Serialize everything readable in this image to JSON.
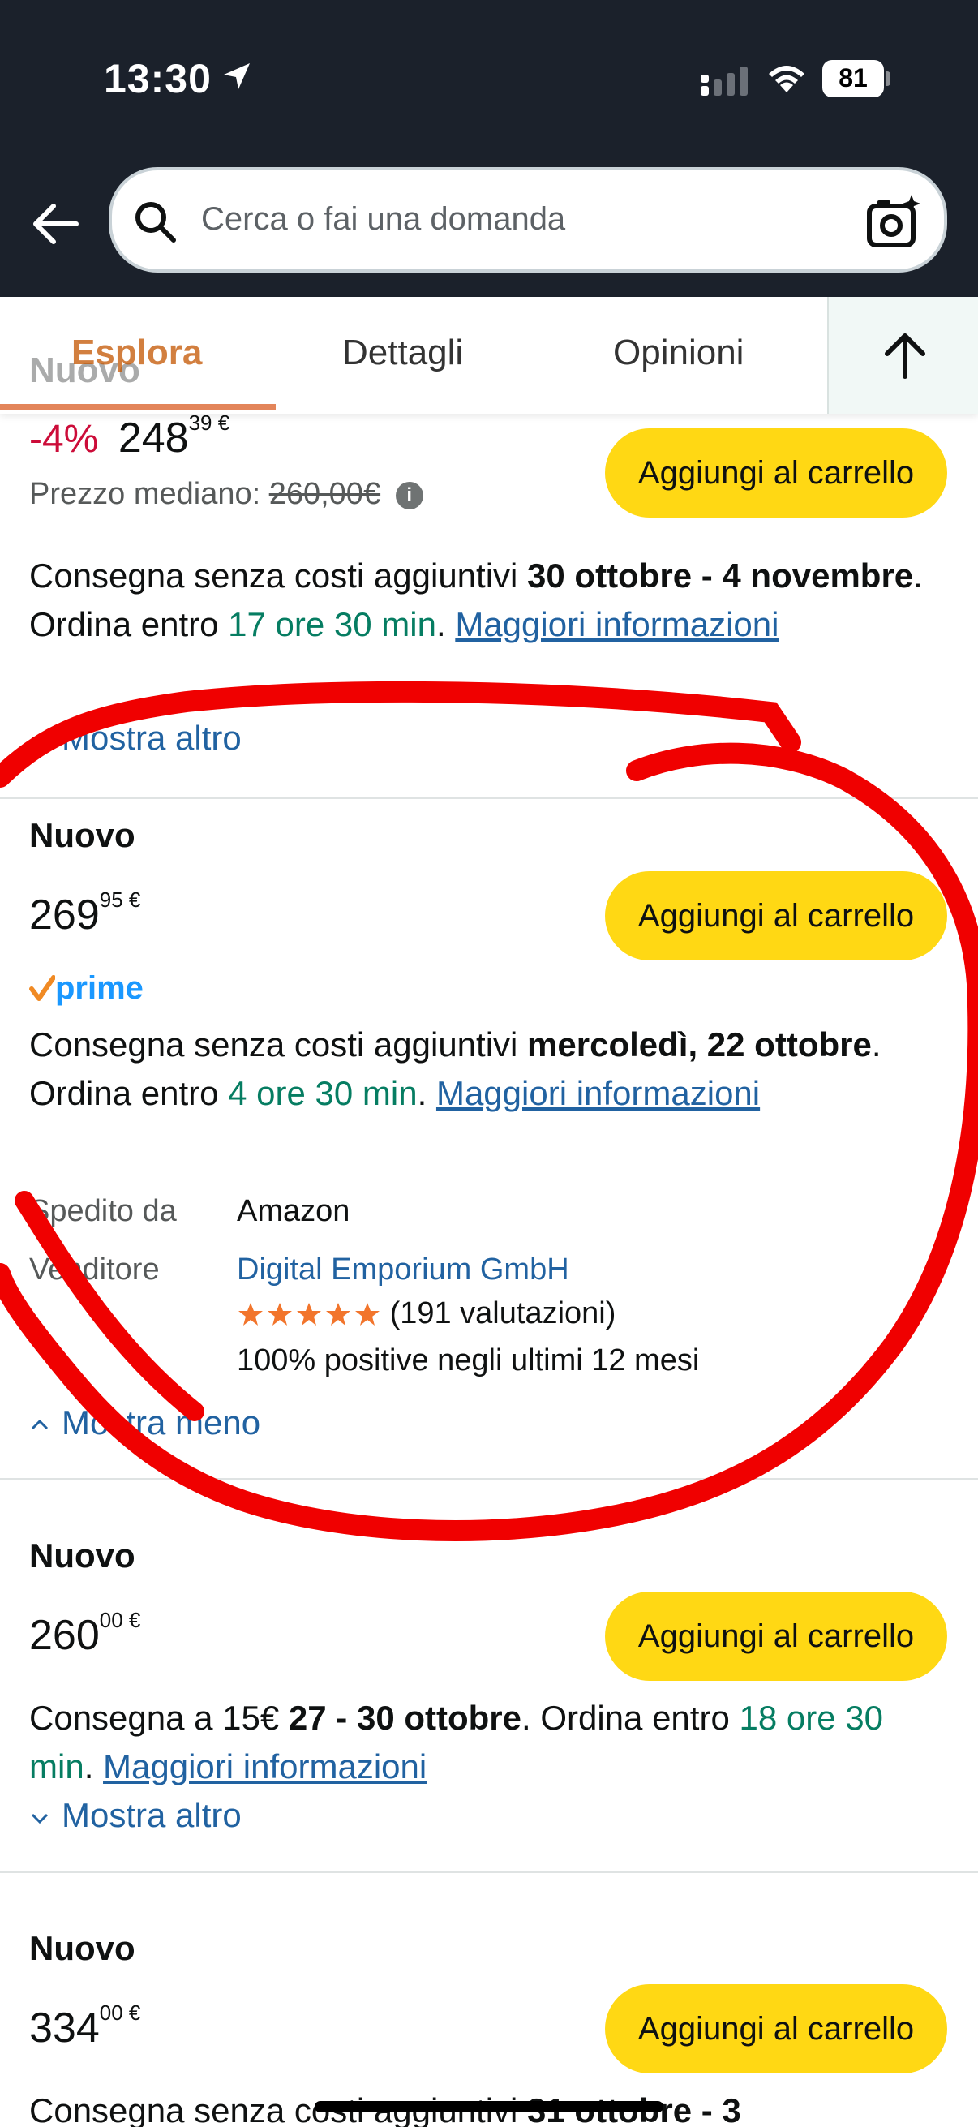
{
  "status_bar": {
    "time": "13:30",
    "battery": "81"
  },
  "search": {
    "placeholder": "Cerca o fai una domanda"
  },
  "tabs": [
    {
      "label": "Esplora",
      "active": true
    },
    {
      "label": "Dettagli",
      "active": false
    },
    {
      "label": "Opinioni",
      "active": false
    }
  ],
  "offers": [
    {
      "condition": "Nuovo",
      "discount": "-4%",
      "price_whole": "248",
      "price_fraction": "39",
      "currency": "€",
      "median_label": "Prezzo mediano:",
      "median_price": "260,00€",
      "cart_label": "Aggiungi al carrello",
      "delivery_prefix": "Consegna senza costi aggiuntivi ",
      "delivery_date": "30 ottobre - 4 novembre",
      "order_within_prefix": ". Ordina entro ",
      "order_within": "17 ore 30 min",
      "more_info": "Maggiori informazioni",
      "toggle": "Mostra altro"
    },
    {
      "condition": "Nuovo",
      "price_whole": "269",
      "price_fraction": "95",
      "currency": "€",
      "cart_label": "Aggiungi al carrello",
      "badge": "prime",
      "delivery_prefix": "Consegna senza costi aggiuntivi ",
      "delivery_date": "mercoledì, 22 ottobre",
      "order_within_prefix": ". Ordina entro ",
      "order_within": "4 ore 30 min",
      "more_info": "Maggiori informazioni",
      "shipped_by_label": "Spedito da",
      "shipped_by": "Amazon",
      "seller_label": "Venditore",
      "seller": "Digital Emporium GmbH",
      "rating_stars": 5,
      "rating_count": "(191 valutazioni)",
      "positive": "100% positive negli ultimi 12 mesi",
      "toggle": "Mostra meno"
    },
    {
      "condition": "Nuovo",
      "price_whole": "260",
      "price_fraction": "00",
      "currency": "€",
      "cart_label": "Aggiungi al carrello",
      "delivery_prefix": "Consegna a 15€ ",
      "delivery_date": "27 - 30 ottobre",
      "order_within_prefix": ". Ordina entro ",
      "order_within": "18 ore 30 min",
      "more_info": "Maggiori informazioni",
      "toggle": "Mostra altro"
    },
    {
      "condition": "Nuovo",
      "price_whole": "334",
      "price_fraction": "00",
      "currency": "€",
      "cart_label": "Aggiungi al carrello",
      "delivery_partial_prefix": "Consegna senza costi aggiuntivi ",
      "delivery_partial_date": "31 ottobre - 3"
    }
  ],
  "colors": {
    "header_bg": "#1b212b",
    "cart_button": "#ffd814",
    "link": "#2162a1",
    "green": "#067d62",
    "discount": "#cc0c39",
    "active_tab": "#c45500",
    "annotation": "#ff0000",
    "star": "#f2752c"
  }
}
